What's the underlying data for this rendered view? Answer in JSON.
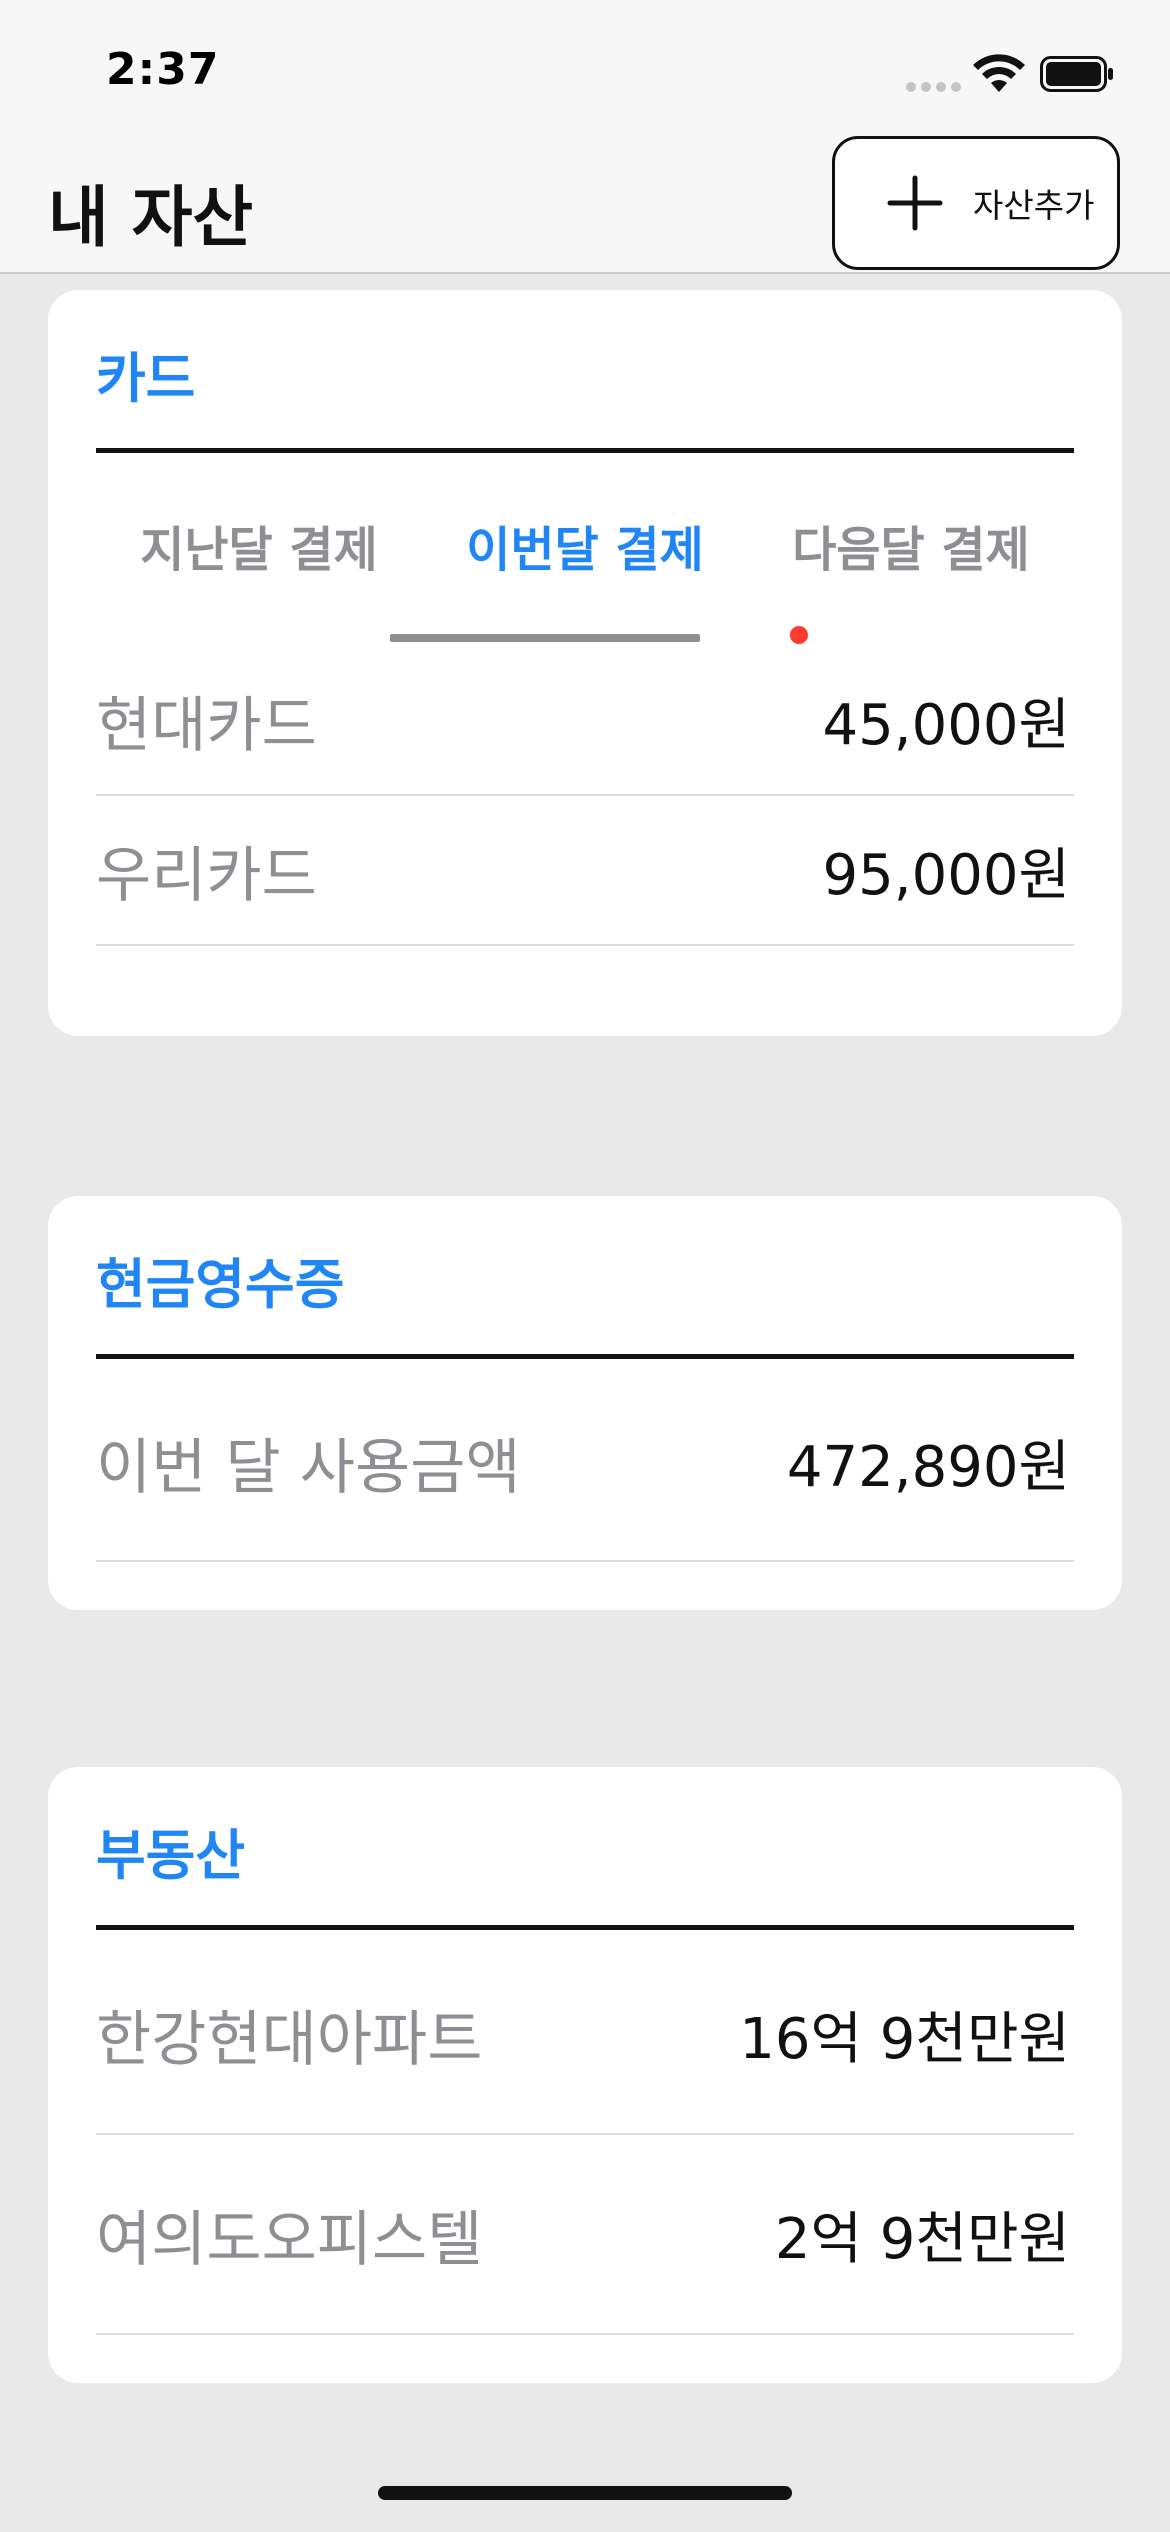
{
  "status_bar": {
    "time": "2:37",
    "icons": [
      "signal-dots-icon",
      "wifi-icon",
      "battery-icon"
    ]
  },
  "header": {
    "title": "내 자산",
    "add_button_label": "자산추가",
    "add_button_icon": "plus-icon"
  },
  "colors": {
    "accent": "#2186f5",
    "secondary_text": "#8e8e93",
    "primary_text": "#111111",
    "background": "#e9e9e9",
    "notification_dot": "#ff3b30"
  },
  "card_section": {
    "title": "카드",
    "tabs": [
      {
        "label": "지난달 결제",
        "active": false
      },
      {
        "label": "이번달 결제",
        "active": true
      },
      {
        "label": "다음달 결제",
        "active": false,
        "has_new_dot": true
      }
    ],
    "rows": [
      {
        "label": "현대카드",
        "value": "45,000원"
      },
      {
        "label": "우리카드",
        "value": "95,000원"
      }
    ]
  },
  "cash_receipt_section": {
    "title": "현금영수증",
    "rows": [
      {
        "label": "이번 달 사용금액",
        "value": "472,890원"
      }
    ]
  },
  "real_estate_section": {
    "title": "부동산",
    "rows": [
      {
        "label": "한강현대아파트",
        "value": "16억 9천만원"
      },
      {
        "label": "여의도오피스텔",
        "value": "2억 9천만원"
      }
    ]
  }
}
